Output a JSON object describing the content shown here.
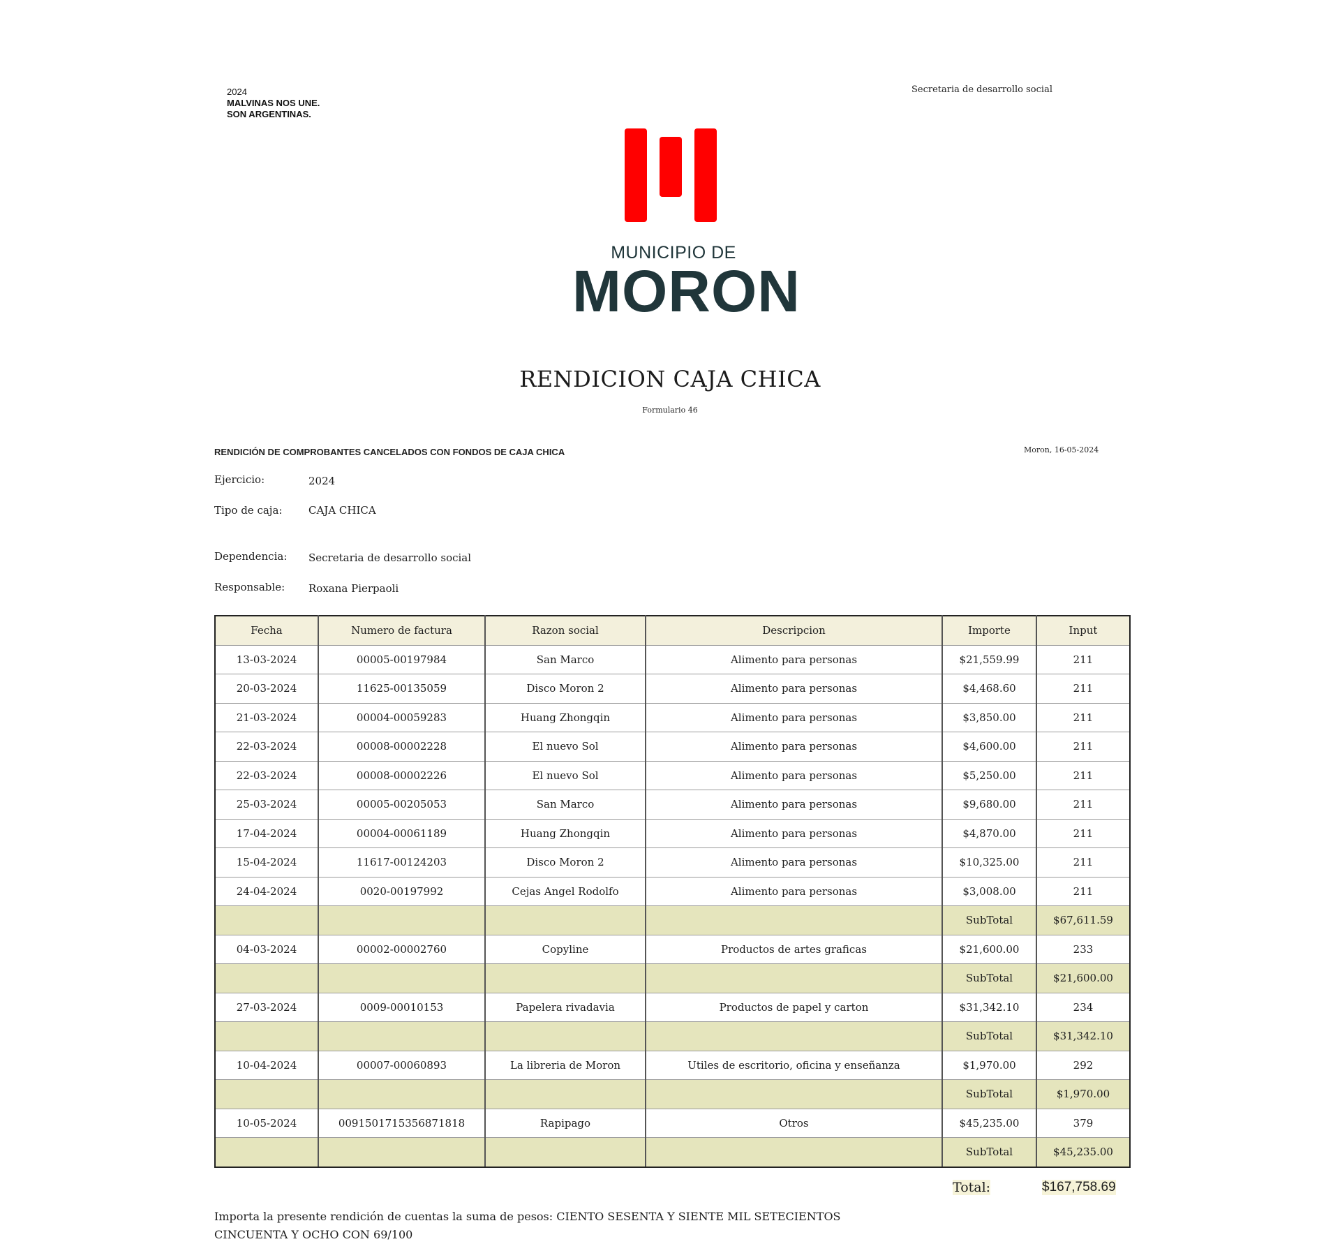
{
  "header": {
    "slogan_year": "2024",
    "slogan_line1": "MALVINAS NOS UNE.",
    "slogan_line2": "SON ARGENTINAS.",
    "department_top": "Secretaria de desarrollo social",
    "logo_line1": "MUNICIPIO DE",
    "logo_line2": "MORON",
    "logo_color": "#ff0000"
  },
  "title": "RENDICION CAJA CHICA",
  "subtitle": "Formulario 46",
  "section_heading": "RENDICIÓN DE COMPROBANTES CANCELADOS CON FONDOS DE CAJA CHICA",
  "place_date": "Moron, 16-05-2024",
  "meta": {
    "ejercicio_label": "Ejercicio:",
    "ejercicio_value": "2024",
    "tipo_label": "Tipo de caja:",
    "tipo_value": "CAJA CHICA",
    "dependencia_label": "Dependencia:",
    "dependencia_value": "Secretaria de desarrollo social",
    "responsable_label": "Responsable:",
    "responsable_value": "Roxana Pierpaoli"
  },
  "table": {
    "headers": [
      "Fecha",
      "Numero de factura",
      "Razon social",
      "Descripcion",
      "Importe",
      "Input"
    ],
    "rows": [
      {
        "type": "item",
        "cells": [
          "13-03-2024",
          "00005-00197984",
          "San Marco",
          "Alimento para personas",
          "$21,559.99",
          "211"
        ]
      },
      {
        "type": "item",
        "cells": [
          "20-03-2024",
          "11625-00135059",
          "Disco Moron 2",
          "Alimento para personas",
          "$4,468.60",
          "211"
        ]
      },
      {
        "type": "item",
        "cells": [
          "21-03-2024",
          "00004-00059283",
          "Huang Zhongqin",
          "Alimento para personas",
          "$3,850.00",
          "211"
        ]
      },
      {
        "type": "item",
        "cells": [
          "22-03-2024",
          "00008-00002228",
          "El nuevo Sol",
          "Alimento para personas",
          "$4,600.00",
          "211"
        ]
      },
      {
        "type": "item",
        "cells": [
          "22-03-2024",
          "00008-00002226",
          "El nuevo Sol",
          "Alimento para personas",
          "$5,250.00",
          "211"
        ]
      },
      {
        "type": "item",
        "cells": [
          "25-03-2024",
          "00005-00205053",
          "San Marco",
          "Alimento para personas",
          "$9,680.00",
          "211"
        ]
      },
      {
        "type": "item",
        "cells": [
          "17-04-2024",
          "00004-00061189",
          "Huang Zhongqin",
          "Alimento para personas",
          "$4,870.00",
          "211"
        ]
      },
      {
        "type": "item",
        "cells": [
          "15-04-2024",
          "11617-00124203",
          "Disco Moron 2",
          "Alimento para personas",
          "$10,325.00",
          "211"
        ]
      },
      {
        "type": "item",
        "cells": [
          "24-04-2024",
          "0020-00197992",
          "Cejas Angel Rodolfo",
          "Alimento para personas",
          "$3,008.00",
          "211"
        ]
      },
      {
        "type": "subtotal",
        "cells": [
          "",
          "",
          "",
          "",
          "SubTotal",
          "$67,611.59"
        ]
      },
      {
        "type": "item",
        "cells": [
          "04-03-2024",
          "00002-00002760",
          "Copyline",
          "Productos de artes graficas",
          "$21,600.00",
          "233"
        ]
      },
      {
        "type": "subtotal",
        "cells": [
          "",
          "",
          "",
          "",
          "SubTotal",
          "$21,600.00"
        ]
      },
      {
        "type": "item",
        "cells": [
          "27-03-2024",
          "0009-00010153",
          "Papelera rivadavia",
          "Productos de papel y carton",
          "$31,342.10",
          "234"
        ]
      },
      {
        "type": "subtotal",
        "cells": [
          "",
          "",
          "",
          "",
          "SubTotal",
          "$31,342.10"
        ]
      },
      {
        "type": "item",
        "cells": [
          "10-04-2024",
          "00007-00060893",
          "La libreria de Moron",
          "Utiles de escritorio, oficina y enseñanza",
          "$1,970.00",
          "292"
        ]
      },
      {
        "type": "subtotal",
        "cells": [
          "",
          "",
          "",
          "",
          "SubTotal",
          "$1,970.00"
        ]
      },
      {
        "type": "item",
        "cells": [
          "10-05-2024",
          "0091501715356871818",
          "Rapipago",
          "Otros",
          "$45,235.00",
          "379"
        ]
      },
      {
        "type": "subtotal",
        "cells": [
          "",
          "",
          "",
          "",
          "SubTotal",
          "$45,235.00"
        ]
      }
    ]
  },
  "total_label": "Total:",
  "total_value": "$167,758.69",
  "amount_words_prefix": "Importa la presente rendición de cuentas la suma de pesos:",
  "amount_words_value": "CIENTO SESENTA Y SIENTE MIL SETECIENTOS CINCUENTA Y OCHO CON 69/100"
}
